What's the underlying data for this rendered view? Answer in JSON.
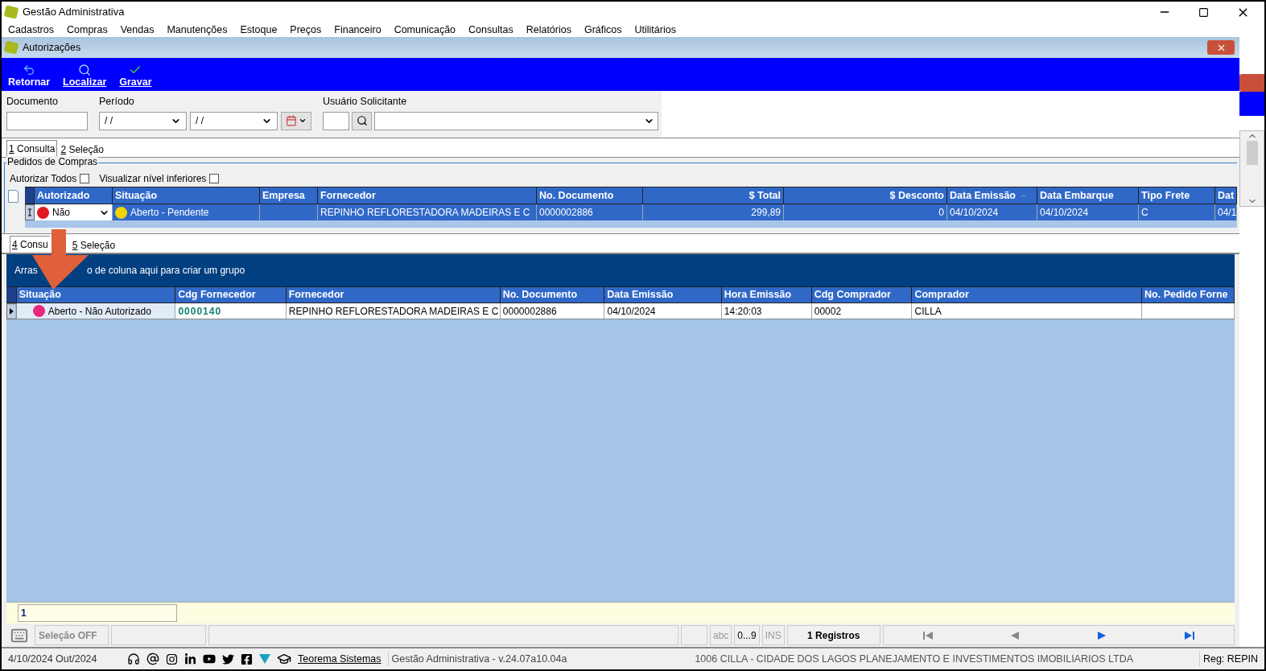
{
  "window": {
    "title": "Gestão Administrativa"
  },
  "menu": [
    "Cadastros",
    "Compras",
    "Vendas",
    "Manutenções",
    "Estoque",
    "Preços",
    "Financeiro",
    "Comunicação",
    "Consultas",
    "Relatórios",
    "Gráficos",
    "Utilitários"
  ],
  "child_window": {
    "title": "Autorizações"
  },
  "toolbar": [
    {
      "label": "Retornar",
      "kind": "back",
      "underlined": false
    },
    {
      "label": "Localizar",
      "kind": "search",
      "underlined": true
    },
    {
      "label": "Gravar",
      "kind": "save",
      "underlined": true
    }
  ],
  "filters": {
    "documento_label": "Documento",
    "periodo_label": "Período",
    "date_from": "/ /",
    "date_to": "/ /",
    "usuario_label": "Usuário Solicitante"
  },
  "tabs_top": [
    {
      "number": "1",
      "label": "Consulta",
      "selected": true
    },
    {
      "number": "2",
      "label": "Seleção",
      "selected": false
    }
  ],
  "group": {
    "title": "Pedidos de Compras",
    "checkboxes": [
      {
        "label": "Autorizar Todos",
        "checked": false
      },
      {
        "label": "Visualizar nível inferiores",
        "checked": false
      }
    ]
  },
  "grid_top": {
    "columns": [
      {
        "label": "Autorizado",
        "sorted": false
      },
      {
        "label": "Situação",
        "sorted": false
      },
      {
        "label": "Empresa",
        "sorted": false
      },
      {
        "label": "Fornecedor",
        "sorted": false
      },
      {
        "label": "No. Documento",
        "sorted": false
      },
      {
        "label": "$ Total",
        "sorted": false
      },
      {
        "label": "$ Desconto",
        "sorted": false
      },
      {
        "label": "Data Emissão",
        "sorted": true
      },
      {
        "label": "Data Embarque",
        "sorted": false
      },
      {
        "label": "Tipo Frete",
        "sorted": false
      },
      {
        "label": "Dat",
        "sorted": false
      }
    ],
    "rows": [
      {
        "selected": true,
        "cells": [
          {
            "text": "Não",
            "color": "#e01822",
            "dropdown": true
          },
          {
            "text": "Aberto - Pendente",
            "color": "#f2d600"
          },
          null,
          {
            "text": "REPINHO REFLORESTADORA MADEIRAS E C"
          },
          {
            "text": "0000002886"
          },
          {
            "text": "299,89"
          },
          {
            "text": "0"
          },
          {
            "text": "04/10/2024"
          },
          {
            "text": "04/10/2024"
          },
          {
            "text": "C"
          },
          {
            "text": "04/1"
          }
        ]
      }
    ]
  },
  "tabs_bottom": [
    {
      "number": "4",
      "label": "Consu",
      "selected": true
    },
    {
      "number": "5",
      "label": "Seleção",
      "selected": false
    }
  ],
  "group_hint": [
    "Arras",
    "o de coluna aqui para criar um grupo"
  ],
  "grid_bottom": {
    "columns": [
      {
        "label": "Situação"
      },
      {
        "label": "Cdg Fornecedor"
      },
      {
        "label": "Fornecedor"
      },
      {
        "label": "No. Documento"
      },
      {
        "label": "Data Emissão"
      },
      {
        "label": "Hora Emissão"
      },
      {
        "label": "Cdg Comprador"
      },
      {
        "label": "Comprador"
      },
      {
        "label": "No. Pedido Forne"
      }
    ],
    "rows": [
      {
        "selected": true,
        "cells": [
          {
            "text": "Aberto - Não Autorizado",
            "color": "#e8287a"
          },
          {
            "text": "0000140",
            "bold": true
          },
          {
            "text": "REPINHO REFLORESTADORA MADEIRAS E C"
          },
          {
            "text": "0000002886"
          },
          {
            "text": "04/10/2024"
          },
          {
            "text": "14:20:03"
          },
          {
            "text": "00002"
          },
          {
            "text": "CILLA"
          },
          null
        ]
      }
    ]
  },
  "footer_field": "1",
  "status": {
    "selection": "Seleção OFF",
    "abc": "abc",
    "digits": "0...9",
    "ins": "INS",
    "records": "1 Registros"
  },
  "bottom_bar": {
    "date": "4/10/2024 Out/2024",
    "link": "Teorema Sistemas",
    "version": "Gestão Administrativa - v.24.07a10.04a",
    "company": "1006 CILLA - CIDADE DOS LAGOS PLANEJAMENTO E INVESTIMENTOS IMOBILIARIOS LTDA",
    "reg": "Reg: REPIN"
  }
}
